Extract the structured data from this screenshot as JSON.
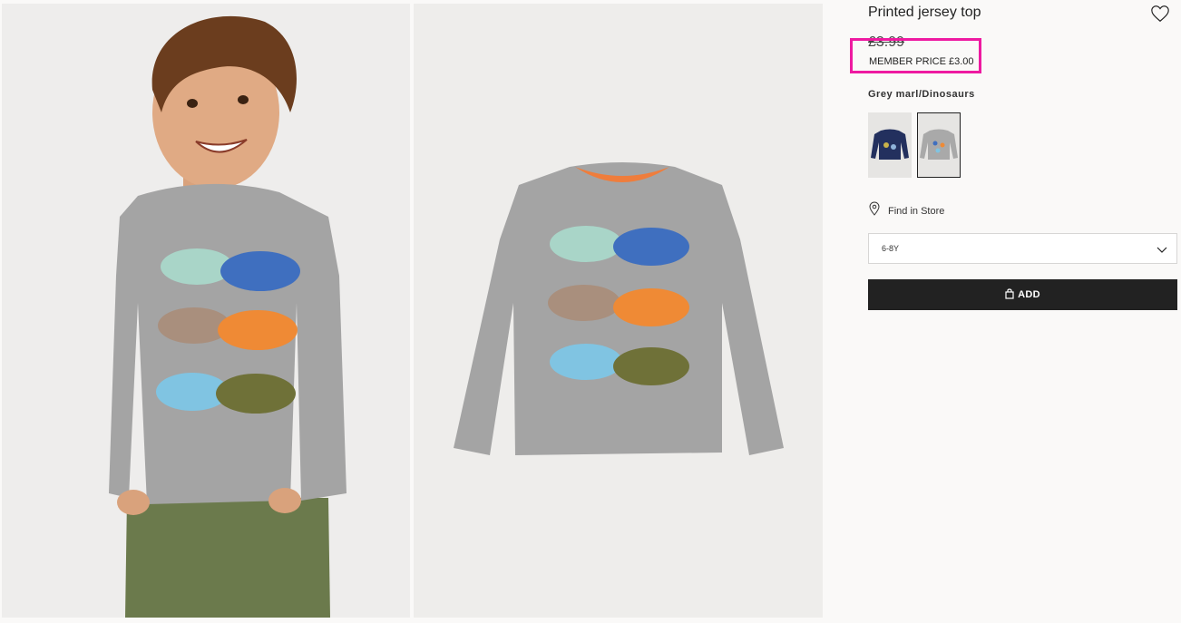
{
  "product": {
    "title": "Printed jersey top",
    "price_original": "£3.99",
    "member_price": "MEMBER PRICE £3.00",
    "color_label": "Grey marl/Dinosaurs",
    "swatches": [
      {
        "color": "navy",
        "selected": false
      },
      {
        "color": "grey-marl",
        "selected": true
      }
    ]
  },
  "actions": {
    "find_in_store": "Find in Store",
    "size_selected": "6-8Y",
    "add_label": "ADD",
    "favorite_icon": "heart-icon",
    "location_icon": "location-pin-icon",
    "dropdown_icon": "chevron-down-icon",
    "bag_icon": "shopping-bag-icon"
  },
  "colors": {
    "highlight": "#ee1aa1",
    "button": "#222222",
    "background": "#faf9f8"
  }
}
